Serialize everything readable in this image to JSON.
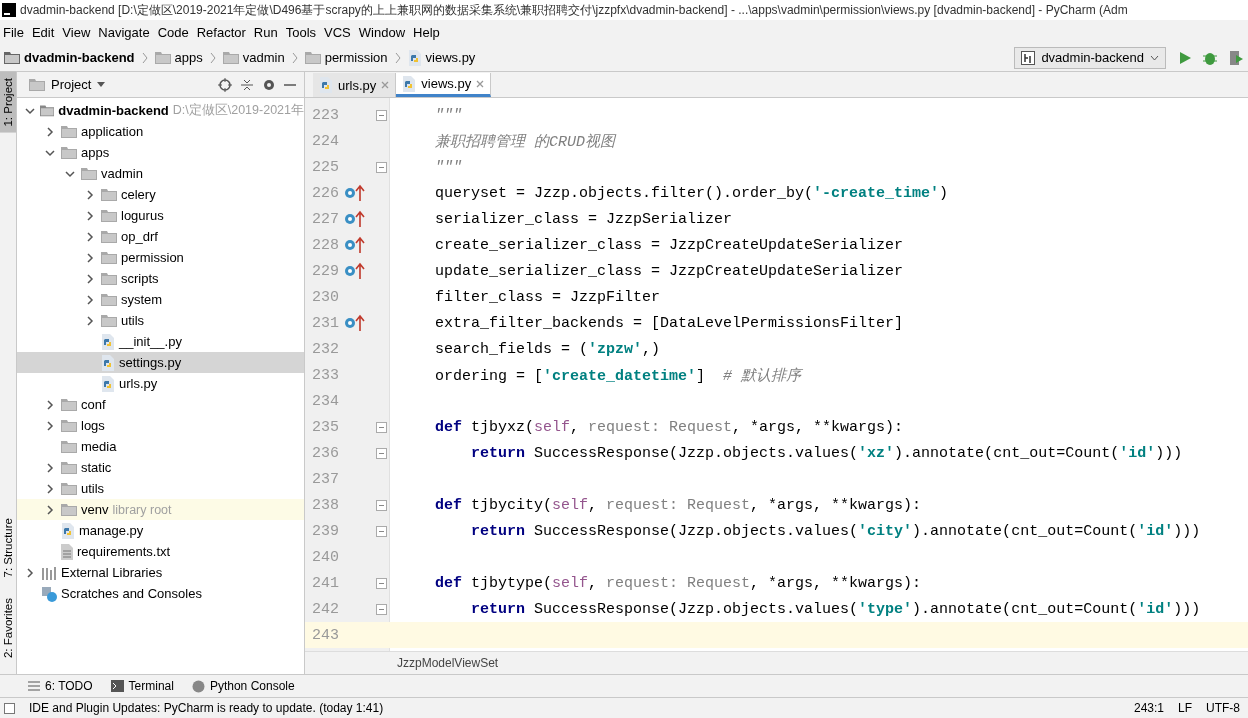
{
  "window": {
    "title": "dvadmin-backend [D:\\定做区\\2019-2021年定做\\D496基于scrapy的上上兼职网的数据采集系统\\兼职招聘交付\\jzzpfx\\dvadmin-backend] - ...\\apps\\vadmin\\permission\\views.py [dvadmin-backend] - PyCharm (Adm"
  },
  "menu": [
    "File",
    "Edit",
    "View",
    "Navigate",
    "Code",
    "Refactor",
    "Run",
    "Tools",
    "VCS",
    "Window",
    "Help"
  ],
  "navigation": {
    "crumbs": [
      {
        "label": "dvadmin-backend",
        "kind": "project"
      },
      {
        "label": "apps",
        "kind": "folder"
      },
      {
        "label": "vadmin",
        "kind": "folder"
      },
      {
        "label": "permission",
        "kind": "folder"
      },
      {
        "label": "views.py",
        "kind": "python"
      }
    ],
    "run_config": "dvadmin-backend"
  },
  "side_strip": {
    "top": [
      {
        "label": "1: Project",
        "selected": true
      }
    ],
    "bottom": [
      {
        "label": "7: Structure",
        "selected": false
      },
      {
        "label": "2: Favorites",
        "selected": false
      }
    ]
  },
  "project_panel": {
    "title": "Project",
    "tree": [
      {
        "label": "dvadmin-backend",
        "kind": "root",
        "hint": "D:\\定做区\\2019-2021年",
        "expanded": true,
        "selected": false,
        "children": [
          {
            "label": "application",
            "kind": "folder",
            "expanded": false,
            "selected": false
          },
          {
            "label": "apps",
            "kind": "folder",
            "expanded": true,
            "selected": false,
            "children": [
              {
                "label": "vadmin",
                "kind": "folder",
                "expanded": true,
                "selected": false,
                "children": [
                  {
                    "label": "celery",
                    "kind": "folder",
                    "expanded": false,
                    "selected": false
                  },
                  {
                    "label": "logurus",
                    "kind": "folder",
                    "expanded": false,
                    "selected": false
                  },
                  {
                    "label": "op_drf",
                    "kind": "folder",
                    "expanded": false,
                    "selected": false
                  },
                  {
                    "label": "permission",
                    "kind": "folder",
                    "expanded": false,
                    "selected": false
                  },
                  {
                    "label": "scripts",
                    "kind": "folder",
                    "expanded": false,
                    "selected": false
                  },
                  {
                    "label": "system",
                    "kind": "folder",
                    "expanded": false,
                    "selected": false
                  },
                  {
                    "label": "utils",
                    "kind": "folder",
                    "expanded": false,
                    "selected": false
                  },
                  {
                    "label": "__init__.py",
                    "kind": "python",
                    "selected": false
                  },
                  {
                    "label": "settings.py",
                    "kind": "python",
                    "selected": true
                  },
                  {
                    "label": "urls.py",
                    "kind": "python",
                    "selected": false
                  }
                ]
              }
            ]
          },
          {
            "label": "conf",
            "kind": "folder",
            "expanded": false,
            "selected": false
          },
          {
            "label": "logs",
            "kind": "folder",
            "expanded": false,
            "selected": false
          },
          {
            "label": "media",
            "kind": "folder",
            "selected": false
          },
          {
            "label": "static",
            "kind": "folder",
            "expanded": false,
            "selected": false
          },
          {
            "label": "utils",
            "kind": "folder",
            "expanded": false,
            "selected": false
          },
          {
            "label": "venv",
            "kind": "folder",
            "hint": "library root",
            "highlighted": true,
            "expanded": false,
            "selected": false
          },
          {
            "label": "manage.py",
            "kind": "python",
            "selected": false
          },
          {
            "label": "requirements.txt",
            "kind": "text",
            "selected": false
          }
        ]
      },
      {
        "label": "External Libraries",
        "kind": "libraries",
        "expanded": false,
        "selected": false
      },
      {
        "label": "Scratches and Consoles",
        "kind": "scratches",
        "selected": false
      }
    ]
  },
  "editor": {
    "tabs": [
      {
        "label": "urls.py",
        "selected": false
      },
      {
        "label": "views.py",
        "selected": true
      }
    ],
    "lines": [
      {
        "number": "223",
        "fold": true,
        "tokens": [
          {
            "kind": "docstring",
            "text": "    \"\"\""
          }
        ]
      },
      {
        "number": "224",
        "tokens": [
          {
            "kind": "docstring",
            "text": "    兼职招聘管理 的CRUD视图"
          }
        ]
      },
      {
        "number": "225",
        "fold": true,
        "tokens": [
          {
            "kind": "docstring",
            "text": "    \"\"\""
          }
        ]
      },
      {
        "number": "226",
        "override": true,
        "tokens": [
          {
            "kind": "plain",
            "text": "    queryset = Jzzp.objects.filter().order_by("
          },
          {
            "kind": "string",
            "text": "'-create_time'"
          },
          {
            "kind": "plain",
            "text": ")"
          }
        ]
      },
      {
        "number": "227",
        "override": true,
        "tokens": [
          {
            "kind": "plain",
            "text": "    serializer_class = JzzpSerializer"
          }
        ]
      },
      {
        "number": "228",
        "override": true,
        "tokens": [
          {
            "kind": "plain",
            "text": "    create_serializer_class = JzzpCreateUpdateSerializer"
          }
        ]
      },
      {
        "number": "229",
        "override": true,
        "tokens": [
          {
            "kind": "plain",
            "text": "    update_serializer_class = JzzpCreateUpdateSerializer"
          }
        ]
      },
      {
        "number": "230",
        "tokens": [
          {
            "kind": "plain",
            "text": "    filter_class = JzzpFilter"
          }
        ]
      },
      {
        "number": "231",
        "override": true,
        "tokens": [
          {
            "kind": "plain",
            "text": "    extra_filter_backends = [DataLevelPermissionsFilter]"
          }
        ]
      },
      {
        "number": "232",
        "tokens": [
          {
            "kind": "plain",
            "text": "    search_fields = ("
          },
          {
            "kind": "string",
            "text": "'zpzw'"
          },
          {
            "kind": "plain",
            "text": ",)"
          }
        ]
      },
      {
        "number": "233",
        "tokens": [
          {
            "kind": "plain",
            "text": "    ordering = ["
          },
          {
            "kind": "string",
            "text": "'create_datetime'"
          },
          {
            "kind": "plain",
            "text": "]  "
          },
          {
            "kind": "comment",
            "text": "# 默认排序"
          }
        ]
      },
      {
        "number": "234"
      },
      {
        "number": "235",
        "fold": true,
        "tokens": [
          {
            "kind": "keyword",
            "text": "    def "
          },
          {
            "kind": "plain",
            "text": "tjbyxz("
          },
          {
            "kind": "self",
            "text": "self"
          },
          {
            "kind": "plain",
            "text": ", "
          },
          {
            "kind": "unused",
            "text": "request: Request"
          },
          {
            "kind": "plain",
            "text": ", *args, **kwargs):"
          }
        ]
      },
      {
        "number": "236",
        "fold": true,
        "tokens": [
          {
            "kind": "keyword",
            "text": "        return "
          },
          {
            "kind": "plain",
            "text": "SuccessResponse(Jzzp.objects.values("
          },
          {
            "kind": "string",
            "text": "'xz'"
          },
          {
            "kind": "plain",
            "text": ").annotate(cnt_out=Count("
          },
          {
            "kind": "string",
            "text": "'id'"
          },
          {
            "kind": "plain",
            "text": ")))"
          }
        ]
      },
      {
        "number": "237"
      },
      {
        "number": "238",
        "fold": true,
        "tokens": [
          {
            "kind": "keyword",
            "text": "    def "
          },
          {
            "kind": "plain",
            "text": "tjbycity("
          },
          {
            "kind": "self",
            "text": "self"
          },
          {
            "kind": "plain",
            "text": ", "
          },
          {
            "kind": "unused",
            "text": "request: Request"
          },
          {
            "kind": "plain",
            "text": ", *args, **kwargs):"
          }
        ]
      },
      {
        "number": "239",
        "fold": true,
        "tokens": [
          {
            "kind": "keyword",
            "text": "        return "
          },
          {
            "kind": "plain",
            "text": "SuccessResponse(Jzzp.objects.values("
          },
          {
            "kind": "string",
            "text": "'city'"
          },
          {
            "kind": "plain",
            "text": ").annotate(cnt_out=Count("
          },
          {
            "kind": "string",
            "text": "'id'"
          },
          {
            "kind": "plain",
            "text": ")))"
          }
        ]
      },
      {
        "number": "240"
      },
      {
        "number": "241",
        "fold": true,
        "tokens": [
          {
            "kind": "keyword",
            "text": "    def "
          },
          {
            "kind": "plain",
            "text": "tjbytype("
          },
          {
            "kind": "self",
            "text": "self"
          },
          {
            "kind": "plain",
            "text": ", "
          },
          {
            "kind": "unused",
            "text": "request: Request"
          },
          {
            "kind": "plain",
            "text": ", *args, **kwargs):"
          }
        ]
      },
      {
        "number": "242",
        "fold": true,
        "tokens": [
          {
            "kind": "keyword",
            "text": "        return "
          },
          {
            "kind": "plain",
            "text": "SuccessResponse(Jzzp.objects.values("
          },
          {
            "kind": "string",
            "text": "'type'"
          },
          {
            "kind": "plain",
            "text": ").annotate(cnt_out=Count("
          },
          {
            "kind": "string",
            "text": "'id'"
          },
          {
            "kind": "plain",
            "text": ")))"
          }
        ]
      },
      {
        "number": "243",
        "current": true
      }
    ],
    "breadcrumb": "JzzpModelViewSet"
  },
  "tool_tabs": [
    {
      "label": "6: TODO",
      "kind": "todo"
    },
    {
      "label": "Terminal",
      "kind": "terminal"
    },
    {
      "label": "Python Console",
      "kind": "console"
    }
  ],
  "status_bar": {
    "message": "IDE and Plugin Updates: PyCharm is ready to update. (today 1:41)",
    "position": "243:1",
    "line_separator": "LF",
    "encoding": "UTF-8"
  }
}
